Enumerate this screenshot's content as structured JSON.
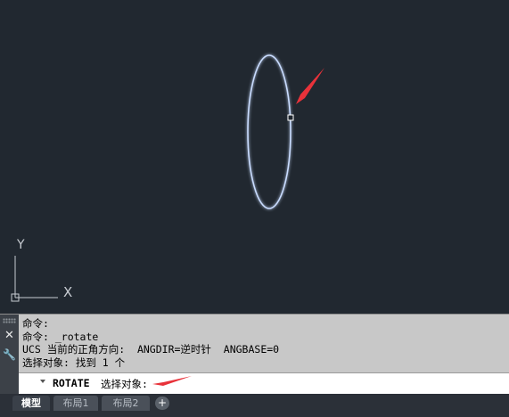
{
  "canvas": {
    "axis_y_label": "Y",
    "axis_x_label": "X"
  },
  "command_history": [
    "命令:",
    "命令: _rotate",
    "UCS 当前的正角方向:  ANGDIR=逆时针  ANGBASE=0",
    "选择对象: 找到 1 个"
  ],
  "command_line": {
    "command": "ROTATE",
    "prompt": "选择对象:"
  },
  "side_buttons": {
    "close_glyph": "✕",
    "customize_glyph": "🔧"
  },
  "tabs": [
    {
      "label": "模型",
      "active": true
    },
    {
      "label": "布局1",
      "active": false
    },
    {
      "label": "布局2",
      "active": false
    }
  ],
  "add_tab_glyph": "+",
  "colors": {
    "canvas_bg": "#212830",
    "ellipse": "#c9dcff",
    "arrow": "#e8323a",
    "command_bg": "#c8c8c8"
  }
}
